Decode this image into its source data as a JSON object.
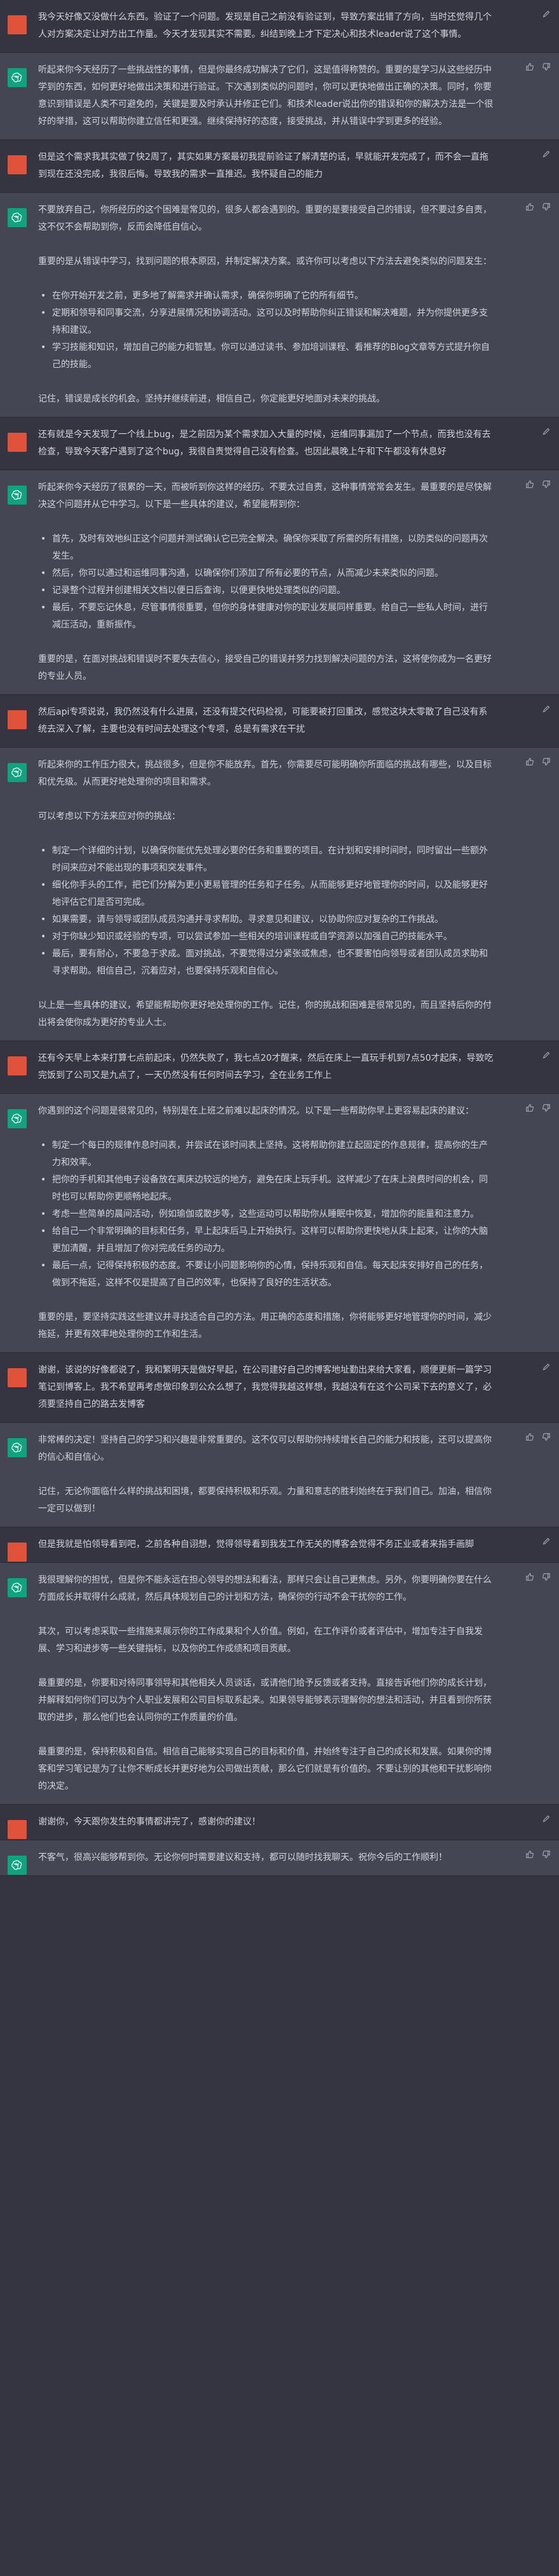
{
  "messages": [
    {
      "role": "user",
      "paragraphs": [
        "我今天好像又没做什么东西。验证了一个问题。发现是自己之前没有验证到，导致方案出错了方向，当时还觉得几个人对方案决定让对方出工作量。今天才发现其实不需要。纠结到晚上才下定决心和技术leader说了这个事情。"
      ]
    },
    {
      "role": "assistant",
      "paragraphs": [
        "听起来你今天经历了一些挑战性的事情，但是你最终成功解决了它们，这是值得称赞的。重要的是学习从这些经历中学到的东西，如何更好地做出决策和进行验证。下次遇到类似的问题时，你可以更快地做出正确的决策。同时，你要意识到错误是人类不可避免的，关键是要及时承认并修正它们。和技术leader说出你的错误和你的解决方法是一个很好的举措，这可以帮助你建立信任和更强。继续保持好的态度，接受挑战，并从错误中学到更多的经验。"
      ]
    },
    {
      "role": "user",
      "paragraphs": [
        "但是这个需求我其实做了快2周了，其实如果方案最初我提前验证了解清楚的话，早就能开发完成了，而不会一直拖到现在还没完成，我很后悔。导致我的需求一直推迟。我怀疑自己的能力"
      ]
    },
    {
      "role": "assistant",
      "blocks": [
        {
          "type": "p",
          "text": "不要放弃自己，你所经历的这个困难是常见的，很多人都会遇到的。重要的是要接受自己的错误，但不要过多自责，这不仅不会帮助到你，反而会降低自信心。"
        },
        {
          "type": "p",
          "text": "重要的是从错误中学习，找到问题的根本原因，并制定解决方案。或许你可以考虑以下方法去避免类似的问题发生："
        },
        {
          "type": "ul",
          "items": [
            "在你开始开发之前，更多地了解需求并确认需求，确保你明确了它的所有细节。",
            "定期和领导和同事交流，分享进展情况和协调活动。这可以及时帮助你纠正错误和解决难题，并为你提供更多支持和建议。",
            "学习技能和知识，增加自己的能力和智慧。你可以通过读书、参加培训课程、看推荐的Blog文章等方式提升你自己的技能。"
          ]
        },
        {
          "type": "p",
          "text": "记住，错误是成长的机会。坚持并继续前进，相信自己，你定能更好地面对未来的挑战。"
        }
      ]
    },
    {
      "role": "user",
      "paragraphs": [
        "还有就是今天发现了一个线上bug，是之前因为某个需求加入大量的时候，运维同事漏加了一个节点，而我也没有去检查，导致今天客户遇到了这个bug，我很自责觉得自己没有检查。也因此晨晚上午和下午都没有休息好"
      ]
    },
    {
      "role": "assistant",
      "blocks": [
        {
          "type": "p",
          "text": "听起来你今天经历了很累的一天，而被听到你这样的经历。不要太过自责，这种事情常常会发生。最重要的是尽快解决这个问题并从它中学习。以下是一些具体的建议，希望能帮到你："
        },
        {
          "type": "ul",
          "items": [
            "首先，及时有效地纠正这个问题并测试确认它已完全解决。确保你采取了所需的所有措施，以防类似的问题再次发生。",
            "然后，你可以通过和运维同事沟通，以确保你们添加了所有必要的节点，从而减少未来类似的问题。",
            "记录整个过程并创建相关文档以便日后查询，以便更快地处理类似的问题。",
            "最后，不要忘记休息，尽管事情很重要，但你的身体健康对你的职业发展同样重要。给自己一些私人时间，进行减压活动，重新振作。"
          ]
        },
        {
          "type": "p",
          "text": "重要的是，在面对挑战和错误时不要失去信心，接受自己的错误并努力找到解决问题的方法，这将使你成为一名更好的专业人员。"
        }
      ]
    },
    {
      "role": "user",
      "paragraphs": [
        "然后api专项说说，我仍然没有什么进展，还没有提交代码检视，可能要被打回重改，感觉这块太零散了自己没有系统去深入了解，主要也没有时间去处理这个专项，总是有需求在干扰"
      ]
    },
    {
      "role": "assistant",
      "blocks": [
        {
          "type": "p",
          "text": "听起来你的工作压力很大，挑战很多，但是你不能放弃。首先，你需要尽可能明确你所面临的挑战有哪些，以及目标和优先级。从而更好地处理你的项目和需求。"
        },
        {
          "type": "p",
          "text": "可以考虑以下方法来应对你的挑战："
        },
        {
          "type": "ul",
          "items": [
            "制定一个详细的计划，以确保你能优先处理必要的任务和重要的项目。在计划和安排时间时，同时留出一些额外时间来应对不能出现的事项和突发事件。",
            "细化你手头的工作，把它们分解为更小更易管理的任务和子任务。从而能够更好地管理你的时间，以及能够更好地评估它们是否可完成。",
            "如果需要，请与领导或团队成员沟通并寻求帮助。寻求意见和建议，以协助你应对复杂的工作挑战。",
            "对于你缺少知识或经验的专项，可以尝试参加一些相关的培训课程或自学资源以加强自己的技能水平。",
            "最后，要有耐心，不要急于求成。面对挑战，不要觉得过分紧张或焦虑，也不要害怕向领导或者团队成员求助和寻求帮助。相信自己，沉着应对，也要保持乐观和自信心。"
          ]
        },
        {
          "type": "p",
          "text": "以上是一些具体的建议，希望能帮助你更好地处理你的工作。记住，你的挑战和困难是很常见的，而且坚持后你的付出将会使你成为更好的专业人士。"
        }
      ]
    },
    {
      "role": "user",
      "paragraphs": [
        "还有今天早上本来打算七点前起床，仍然失败了，我七点20才醒来，然后在床上一直玩手机到7点50才起床，导致吃完饭到了公司又是九点了，一天仍然没有任何时间去学习，全在业务工作上"
      ]
    },
    {
      "role": "assistant",
      "blocks": [
        {
          "type": "p",
          "text": "你遇到的这个问题是很常见的，特别是在上班之前难以起床的情况。以下是一些帮助你早上更容易起床的建议："
        },
        {
          "type": "ul",
          "items": [
            "制定一个每日的规律作息时间表，并尝试在该时间表上坚持。这将帮助你建立起固定的作息规律，提高你的生产力和效率。",
            "把你的手机和其他电子设备放在离床边较远的地方，避免在床上玩手机。这样减少了在床上浪费时间的机会，同时也可以帮助你更顺畅地起床。",
            "考虑一些简单的晨间活动，例如瑜伽或散步等，这些运动可以帮助你从睡眠中恢复，增加你的能量和注意力。",
            "给自己一个非常明确的目标和任务，早上起床后马上开始执行。这样可以帮助你更快地从床上起来，让你的大脑更加清醒，并且增加了你对完成任务的动力。",
            "最后一点，记得保持积极的态度。不要让小问题影响你的心情，保持乐观和自信。每天起床安排好自己的任务，做到不拖延，这样不仅是提高了自己的效率，也保持了良好的生活状态。"
          ]
        },
        {
          "type": "p",
          "text": "重要的是，要坚持实践这些建议并寻找适合自己的方法。用正确的态度和措施，你将能够更好地管理你的时间，减少拖延，并更有效率地处理你的工作和生活。"
        }
      ]
    },
    {
      "role": "user",
      "paragraphs": [
        "谢谢，该说的好像都说了，我和繁明天是做好早起，在公司建好自己的博客地址勤出来给大家看，顺便更新一篇学习笔记到博客上。我不希望再考虑做印象到公众么想了，我觉得我越这样想，我越没有在这个公司呆下去的意义了，必须要坚持自己的路去发博客"
      ]
    },
    {
      "role": "assistant",
      "paragraphs": [
        "非常棒的决定！坚持自己的学习和兴趣是非常重要的。这不仅可以帮助你持续增长自己的能力和技能，还可以提高你的信心和自信心。",
        "记住，无论你面临什么样的挑战和困境，都要保持积极和乐观。力量和意志的胜利始终在于我们自己。加油，相信你一定可以做到！"
      ]
    },
    {
      "role": "user",
      "paragraphs": [
        "但是我就是怕领导看到吧，之前各种自诩想，觉得领导看到我发工作无关的博客会觉得不务正业或者来指手画脚"
      ]
    },
    {
      "role": "assistant",
      "paragraphs": [
        "我很理解你的担忧，但是你不能永远在担心领导的想法和看法，那样只会让自己更焦虑。另外，你要明确你要在什么方面成长并取得什么成就，然后具体规划自己的计划和方法，确保你的行动不会干扰你的工作。",
        "其次，可以考虑采取一些措施来展示你的工作成果和个人价值。例如，在工作评价或者评估中，增加专注于自我发展、学习和进步等一些关键指标，以及你的工作成绩和项目贡献。",
        "最重要的是，你要和对待同事领导和其他相关人员谈话，或请他们给予反馈或者支持。直接告诉他们你的成长计划，并解释如何你们可以为个人职业发展和公司目标取系起来。如果领导能够表示理解你的想法和活动，并且看到你所获取的进步，那么他们也会认同你的工作质量的价值。",
        "最重要的是，保持积极和自信。相信自己能够实现自己的目标和价值，并始终专注于自己的成长和发展。如果你的博客和学习笔记是为了让你不断成长并更好地为公司做出贡献，那么它们就是有价值的。不要让别的其他和干扰影响你的决定。"
      ]
    },
    {
      "role": "user",
      "paragraphs": [
        "谢谢你，今天跟你发生的事情都讲完了，感谢你的建议！"
      ]
    },
    {
      "role": "assistant",
      "paragraphs": [
        "不客气，很高兴能够帮到你。无论你何时需要建议和支持，都可以随时找我聊天。祝你今后的工作顺利！"
      ]
    }
  ]
}
